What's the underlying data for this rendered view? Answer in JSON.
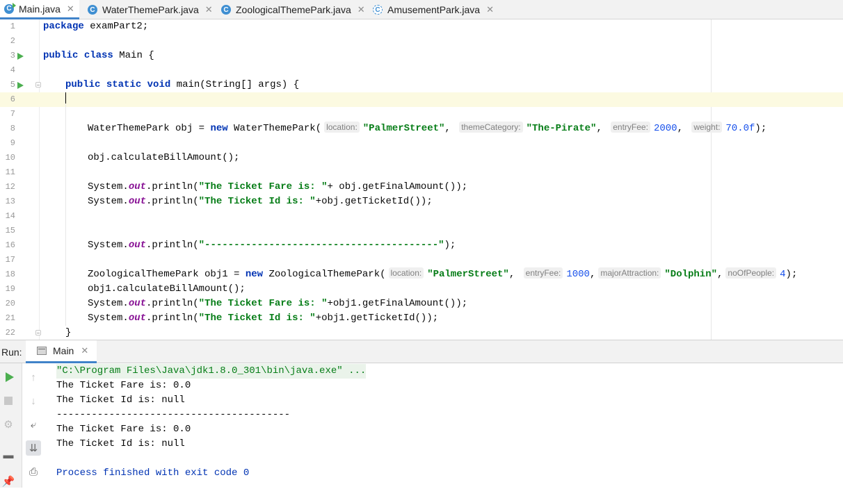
{
  "tabs": [
    {
      "label": "Main.java",
      "icon": "class-main-icon",
      "active": true
    },
    {
      "label": "WaterThemePark.java",
      "icon": "class-icon",
      "active": false
    },
    {
      "label": "ZoologicalThemePark.java",
      "icon": "class-icon",
      "active": false
    },
    {
      "label": "AmusementPark.java",
      "icon": "abstract-class-icon",
      "active": false
    }
  ],
  "editor": {
    "line_numbers": [
      "1",
      "2",
      "3",
      "4",
      "5",
      "6",
      "7",
      "8",
      "9",
      "10",
      "11",
      "12",
      "13",
      "14",
      "15",
      "16",
      "17",
      "18",
      "19",
      "20",
      "21",
      "22"
    ],
    "line1": {
      "kw": "package",
      "rest": " examPart2;"
    },
    "line3": {
      "kw1": "public",
      "kw2": "class",
      "rest": " Main {"
    },
    "line5": {
      "kw1": "public",
      "kw2": "static",
      "kw3": "void",
      "rest": " main(String[] args) {"
    },
    "line8": {
      "pre": "WaterThemePark obj = ",
      "kw": "new",
      "call": " WaterThemePark(",
      "hint1": "location:",
      "arg1": "\"PalmerStreet\"",
      "sep1": ",",
      "hint2": "themeCategory:",
      "arg2": "\"The-Pirate\"",
      "sep2": ",",
      "hint3": "entryFee:",
      "arg3": "2000",
      "sep3": ",",
      "hint4": "weight:",
      "arg4": "70.0f",
      "end": ");"
    },
    "line10": {
      "text": "obj.calculateBillAmount();"
    },
    "line12": {
      "pre": "System.",
      "field": "out",
      "mid": ".println(",
      "str": "\"The Ticket Fare is: \"",
      "post": "+ obj.getFinalAmount());"
    },
    "line13": {
      "pre": "System.",
      "field": "out",
      "mid": ".println(",
      "str": "\"The Ticket Id is: \"",
      "post": "+obj.getTicketId());"
    },
    "line16": {
      "pre": "System.",
      "field": "out",
      "mid": ".println(",
      "str": "\"----------------------------------------\"",
      "post": ");"
    },
    "line18": {
      "pre": "ZoologicalThemePark obj1 = ",
      "kw": "new",
      "call": " ZoologicalThemePark(",
      "hint1": "location:",
      "arg1": "\"PalmerStreet\"",
      "sep1": ",",
      "hint2": "entryFee:",
      "arg2": "1000",
      "sep2": ",",
      "hint3": "majorAttraction:",
      "arg3": "\"Dolphin\"",
      "sep3": ",",
      "hint4": "noOfPeople:",
      "arg4": "4",
      "end": ");"
    },
    "line19": {
      "text": "obj1.calculateBillAmount();"
    },
    "line20": {
      "pre": "System.",
      "field": "out",
      "mid": ".println(",
      "str": "\"The Ticket Fare is: \"",
      "post": "+obj1.getFinalAmount());"
    },
    "line21": {
      "pre": "System.",
      "field": "out",
      "mid": ".println(",
      "str": "\"The Ticket Id is: \"",
      "post": "+obj1.getTicketId());"
    },
    "line22": {
      "text": "}"
    }
  },
  "run_panel": {
    "label": "Run:",
    "tab_label": "Main",
    "console": [
      "\"C:\\Program Files\\Java\\jdk1.8.0_301\\bin\\java.exe\" ...",
      "The Ticket Fare is: 0.0",
      "The Ticket Id is: null",
      "----------------------------------------",
      "The Ticket Fare is: 0.0",
      "The Ticket Id is: null",
      "",
      "Process finished with exit code 0"
    ]
  },
  "colors": {
    "keyword": "#0033b3",
    "string": "#067d17",
    "number": "#1750eb",
    "static_field": "#871094",
    "current_line": "#fcfae1",
    "tab_underline": "#4083c9"
  }
}
